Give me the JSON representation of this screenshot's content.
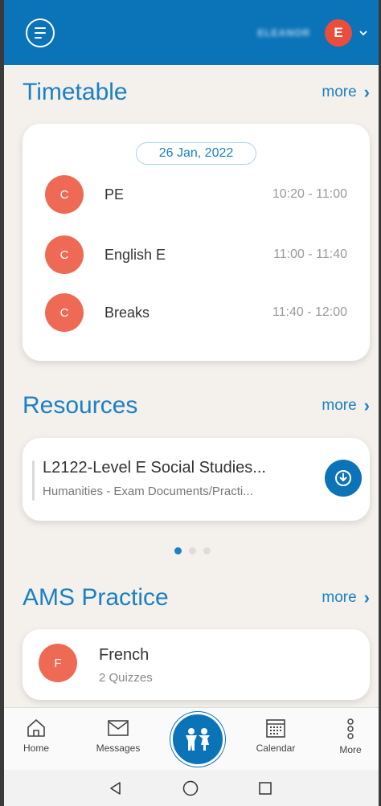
{
  "header": {
    "user_name": "ELEANOR",
    "avatar_initial": "E",
    "colors": {
      "bar": "#0b73b8",
      "avatar": "#ea4d3c"
    }
  },
  "timetable": {
    "title": "Timetable",
    "more_label": "more",
    "date": "26 Jan, 2022",
    "rows": [
      {
        "initial": "C",
        "subject": "PE",
        "time": "10:20 - 11:00"
      },
      {
        "initial": "C",
        "subject": "English E",
        "time": "11:00 - 11:40"
      },
      {
        "initial": "C",
        "subject": "Breaks",
        "time": "11:40 - 12:00"
      }
    ]
  },
  "resources": {
    "title": "Resources",
    "more_label": "more",
    "item": {
      "title": "L2122-Level E Social Studies...",
      "subtitle": "Humanities - Exam Documents/Practi..."
    },
    "pager": {
      "count": 3,
      "active": 0
    }
  },
  "ams": {
    "title": "AMS Practice",
    "more_label": "more",
    "item": {
      "initial": "F",
      "title": "French",
      "subtitle": "2 Quizzes"
    }
  },
  "bottom_nav": {
    "items": [
      {
        "label": "Home",
        "icon": "home-icon"
      },
      {
        "label": "Messages",
        "icon": "envelope-icon"
      },
      {
        "label": "Calendar",
        "icon": "calendar-icon"
      },
      {
        "label": "More",
        "icon": "more-vertical-icon"
      }
    ],
    "center_icon": "kids-icon"
  },
  "system_nav": [
    "back-icon",
    "home-circle-icon",
    "recents-icon"
  ]
}
